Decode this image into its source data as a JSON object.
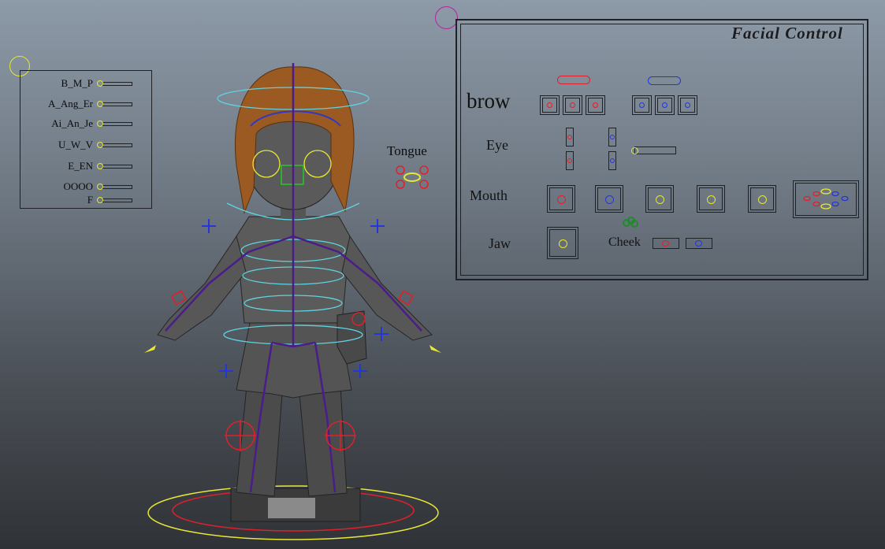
{
  "phoneme_panel": {
    "sliders": [
      {
        "label": "B_M_P"
      },
      {
        "label": "A_Ang_Er"
      },
      {
        "label": "Ai_An_Je"
      },
      {
        "label": "U_W_V"
      },
      {
        "label": "E_EN"
      },
      {
        "label": "OOOO"
      },
      {
        "label": "F"
      }
    ]
  },
  "facial_control": {
    "title": "Facial Control",
    "brow_label": "brow",
    "eye_label": "Eye",
    "mouth_label": "Mouth",
    "jaw_label": "Jaw",
    "cheek_label": "Cheek"
  },
  "viewport": {
    "tongue_label": "Tongue"
  },
  "colors": {
    "left_side": "#e0202a",
    "right_side": "#2436d8",
    "center": "#e8e835",
    "skeleton": "#4a1d8a",
    "guide": "#5fd3e0",
    "panel_border": "#1e2125"
  },
  "icons": [
    "phoneme-panel-handle-icon",
    "facial-panel-handle-icon",
    "tongue-control-icon",
    "cheek-green-icon"
  ]
}
